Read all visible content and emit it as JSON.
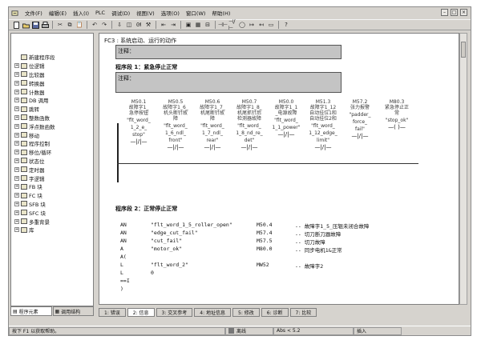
{
  "menubar": [
    "文件(F)",
    "编辑(E)",
    "插入(I)",
    "PLC",
    "调试(D)",
    "视图(V)",
    "选项(O)",
    "窗口(W)",
    "帮助(H)"
  ],
  "tree": [
    {
      "label": "新建程序段",
      "expandable": false
    },
    {
      "label": "位逻辑",
      "expandable": true
    },
    {
      "label": "比较器",
      "expandable": true
    },
    {
      "label": "转换器",
      "expandable": true
    },
    {
      "label": "计数器",
      "expandable": true
    },
    {
      "label": "DB 调用",
      "expandable": true
    },
    {
      "label": "跳转",
      "expandable": true
    },
    {
      "label": "整数函数",
      "expandable": true
    },
    {
      "label": "浮点数函数",
      "expandable": true
    },
    {
      "label": "移动",
      "expandable": true
    },
    {
      "label": "程序控制",
      "expandable": true
    },
    {
      "label": "移位/循环",
      "expandable": true
    },
    {
      "label": "状态位",
      "expandable": true
    },
    {
      "label": "定时器",
      "expandable": true
    },
    {
      "label": "字逻辑",
      "expandable": true
    },
    {
      "label": "FB 块",
      "expandable": true
    },
    {
      "label": "FC 块",
      "expandable": true
    },
    {
      "label": "SFB 块",
      "expandable": true
    },
    {
      "label": "SFC 块",
      "expandable": true
    },
    {
      "label": "多重背景",
      "expandable": true
    },
    {
      "label": "库",
      "expandable": true
    }
  ],
  "left_tabs": [
    "程序元素",
    "调用结构"
  ],
  "editor": {
    "block_header": "FC3 : 系统启动、运行的动作",
    "comment_label": "注释：",
    "network1_title": "程序段 1：紧急停止正常",
    "network2_title": "程序段 2：正常停止正常"
  },
  "contacts": [
    {
      "addr": "M50.1",
      "desc": [
        "故障字1_",
        "急停按钮"
      ],
      "sym": [
        "\"flt_word_",
        "1_2_e_",
        "stop\""
      ],
      "glyph": "—|/|—"
    },
    {
      "addr": "M50.5",
      "desc": [
        "故障字1_6_",
        "机头断针故",
        "障"
      ],
      "sym": [
        "\"flt_word_",
        "1_6_ndl_",
        "front\""
      ],
      "glyph": "—|/|—"
    },
    {
      "addr": "M50.6",
      "desc": [
        "故障字1_7_",
        "机尾断针故",
        "障"
      ],
      "sym": [
        "\"flt_word_",
        "1_7_ndl_",
        "rear\""
      ],
      "glyph": "—|/|—"
    },
    {
      "addr": "M50.7",
      "desc": [
        "故障字1_8_",
        "机尾抓针后",
        "检测器故障"
      ],
      "sym": [
        "\"flt_word_",
        "1_8_nd_re_",
        "det\""
      ],
      "glyph": "—|/|—"
    },
    {
      "addr": "M50.0",
      "desc": [
        "故障字1_1",
        "_电源故障"
      ],
      "sym": [
        "\"flt_word_",
        "1_1_power\""
      ],
      "glyph": "—|/|—"
    },
    {
      "addr": "M51.3",
      "desc": [
        "故障字1_12",
        "自动挂位1和",
        "自动挂位2和"
      ],
      "sym": [
        "\"flt_word_",
        "1_12_edge_",
        "limit\""
      ],
      "glyph": "—|/|—"
    },
    {
      "addr": "M57.2",
      "desc": [
        "张力报警"
      ],
      "sym": [
        "\"padder_",
        "force_",
        "fail\""
      ],
      "glyph": "—|/|—"
    },
    {
      "addr": "M80.3",
      "desc": [
        "紧急停止正",
        "常"
      ],
      "sym": [
        "\"stop_ok\""
      ],
      "glyph": "—( )—"
    }
  ],
  "stl": [
    {
      "op": "AN",
      "arg": "\"flt_word_1_5_roller_open\"",
      "adr": "M50.4",
      "cmt": "-- 故障字1_5_压辊未闭合故障"
    },
    {
      "op": "AN",
      "arg": "\"edge_cut_fail\"",
      "adr": "M57.4",
      "cmt": "-- 切刀断刀器故障"
    },
    {
      "op": "AN",
      "arg": "\"cut_fail\"",
      "adr": "M57.5",
      "cmt": "-- 切刀故障"
    },
    {
      "op": "A",
      "arg": "\"motor_ok\"",
      "adr": "M80.0",
      "cmt": "-- 同步电机1&正常"
    },
    {
      "op": "A(",
      "arg": "",
      "adr": "",
      "cmt": ""
    },
    {
      "op": "L",
      "arg": "\"flt_word_2\"",
      "adr": "MW52",
      "cmt": "-- 故障字2"
    },
    {
      "op": "L",
      "arg": "0",
      "adr": "",
      "cmt": ""
    },
    {
      "op": "==I",
      "arg": "",
      "adr": "",
      "cmt": ""
    },
    {
      "op": ")",
      "arg": "",
      "adr": "",
      "cmt": ""
    }
  ],
  "bottom_tabs": [
    "1: 错误",
    "2: 信息",
    "3: 交叉参考",
    "4: 地址信息",
    "5: 修改",
    "6: 诊断",
    "7: 比较"
  ],
  "status": {
    "hint": "按下 F1 以获取帮助。",
    "mode": "离线",
    "position": "Abs < 5.2",
    "insert": "插入"
  }
}
